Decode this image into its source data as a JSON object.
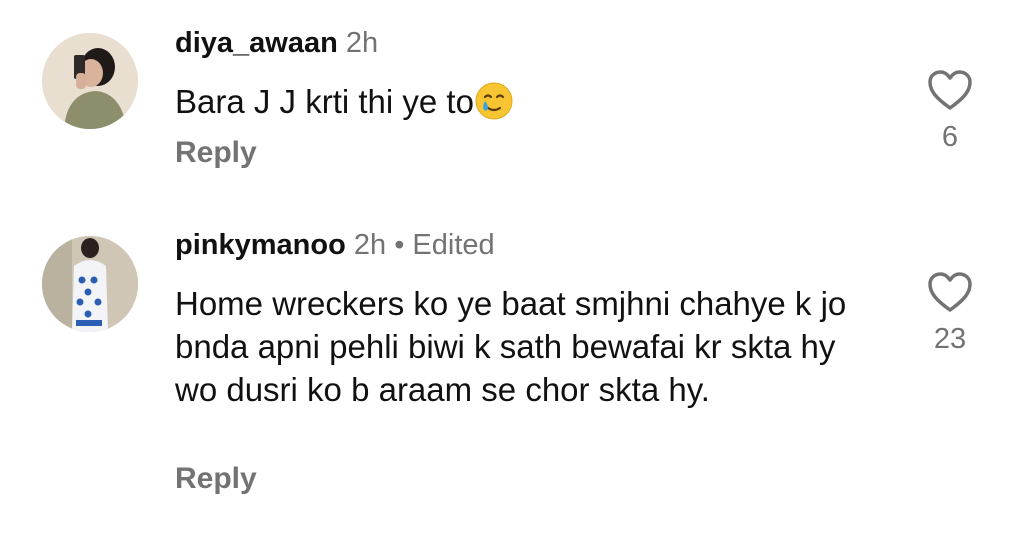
{
  "colors": {
    "text_primary": "#111111",
    "text_secondary": "#737373",
    "background": "#ffffff"
  },
  "comments": [
    {
      "username": "diya_awaan",
      "time": "2h",
      "edited": "",
      "text": "Bara J J krti thi ye to",
      "emoji": "smiling-face-with-tear",
      "reply_label": "Reply",
      "like_icon": "heart-outline-icon",
      "likes": "6"
    },
    {
      "username": "pinkymanoo",
      "time": "2h",
      "separator": "•",
      "edited": "Edited",
      "text": "Home wreckers ko ye baat smjhni chahye k jo bnda apni pehli biwi k sath bewafai kr skta hy wo dusri ko b araam se chor skta hy.",
      "reply_label": "Reply",
      "like_icon": "heart-outline-icon",
      "likes": "23"
    }
  ]
}
